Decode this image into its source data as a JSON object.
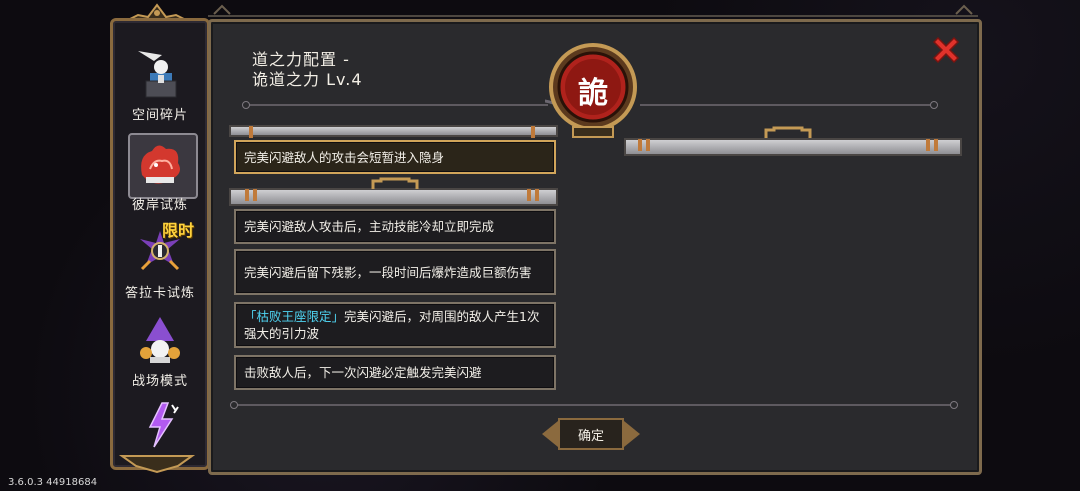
{
  "version": "3.6.0.3 44918684",
  "sidebar": {
    "items": [
      {
        "label": "空间碎片"
      },
      {
        "label": "彼岸试炼"
      },
      {
        "label": "答拉卡试炼",
        "badge": "限时"
      },
      {
        "label": "战场模式"
      },
      {
        "label": ""
      }
    ]
  },
  "dialog": {
    "title_line1": "道之力配置 -",
    "title_line2": "诡道之力 Lv.4",
    "emblem_char": "詭",
    "confirm_label": "确定",
    "selected_option": "完美闪避敌人的攻击会短暂进入隐身",
    "options": [
      {
        "text": "完美闪避敌人攻击后，主动技能冷却立即完成"
      },
      {
        "text": "完美闪避后留下残影，一段时间后爆炸造成巨额伤害"
      },
      {
        "tag": "「枯败王座限定」",
        "text": "完美闪避后，对周围的敌人产生1次强大的引力波"
      },
      {
        "text": "击败敌人后，下一次闪避必定触发完美闪避"
      }
    ]
  },
  "colors": {
    "accent_gold": "#d1a55a",
    "close_red": "#e0322b",
    "tag_cyan": "#4fd4f2",
    "emblem_red": "#b0221c",
    "limited_yellow": "#ffd23c"
  },
  "icons": [
    "space-fragment-icon",
    "beyond-trial-icon",
    "dalaka-trial-icon",
    "battlefield-icon",
    "lightning-icon",
    "close-icon",
    "emblem-icon"
  ]
}
